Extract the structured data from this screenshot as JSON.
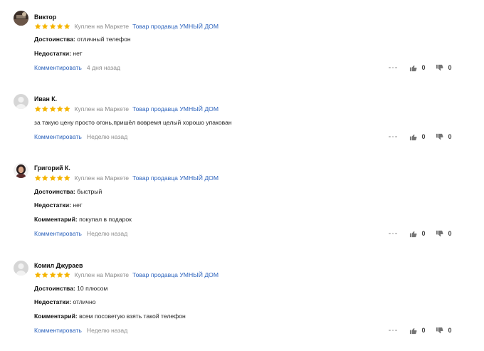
{
  "reviews": [
    {
      "name": "Виктор",
      "avatar": "photo-dark",
      "rating": 5,
      "bought": "Куплен на Маркете",
      "seller": "Товар продавца УМНЫЙ ДОМ",
      "lines": [
        {
          "label": "Достоинства:",
          "text": "отличный телефон"
        },
        {
          "label": "Недостатки:",
          "text": "нет"
        }
      ],
      "comment_label": "Комментировать",
      "date": "4 дня назад",
      "likes": "0",
      "dislikes": "0"
    },
    {
      "name": "Иван К.",
      "avatar": "placeholder",
      "rating": 5,
      "bought": "Куплен на Маркете",
      "seller": "Товар продавца УМНЫЙ ДОМ",
      "lines": [
        {
          "label": "",
          "text": "за такую цену просто огонь,пришёл вовремя целый хорошо упакован"
        }
      ],
      "comment_label": "Комментировать",
      "date": "Неделю назад",
      "likes": "0",
      "dislikes": "0"
    },
    {
      "name": "Григорий К.",
      "avatar": "photo-person",
      "rating": 5,
      "bought": "Куплен на Маркете",
      "seller": "Товар продавца УМНЫЙ ДОМ",
      "lines": [
        {
          "label": "Достоинства:",
          "text": "быстрый"
        },
        {
          "label": "Недостатки:",
          "text": "нет"
        },
        {
          "label": "Комментарий:",
          "text": "покупал в подарок"
        }
      ],
      "comment_label": "Комментировать",
      "date": "Неделю назад",
      "likes": "0",
      "dislikes": "0"
    },
    {
      "name": "Комил Джураев",
      "avatar": "placeholder",
      "rating": 5,
      "bought": "Куплен на Маркете",
      "seller": "Товар продавца УМНЫЙ ДОМ",
      "lines": [
        {
          "label": "Достоинства:",
          "text": "10 плюсом"
        },
        {
          "label": "Недостатки:",
          "text": "отлично"
        },
        {
          "label": "Комментарий:",
          "text": "всем посоветую взять такой телефон"
        }
      ],
      "comment_label": "Комментировать",
      "date": "Неделю назад",
      "likes": "0",
      "dislikes": "0"
    }
  ],
  "colors": {
    "star": "#f5b400",
    "link": "#2e64bd",
    "muted": "#8a8a8a",
    "icon": "#757575"
  },
  "icons": {
    "like": "thumb-up-icon",
    "dislike": "thumb-down-icon",
    "more": "more-dots-icon",
    "star": "star-icon"
  }
}
